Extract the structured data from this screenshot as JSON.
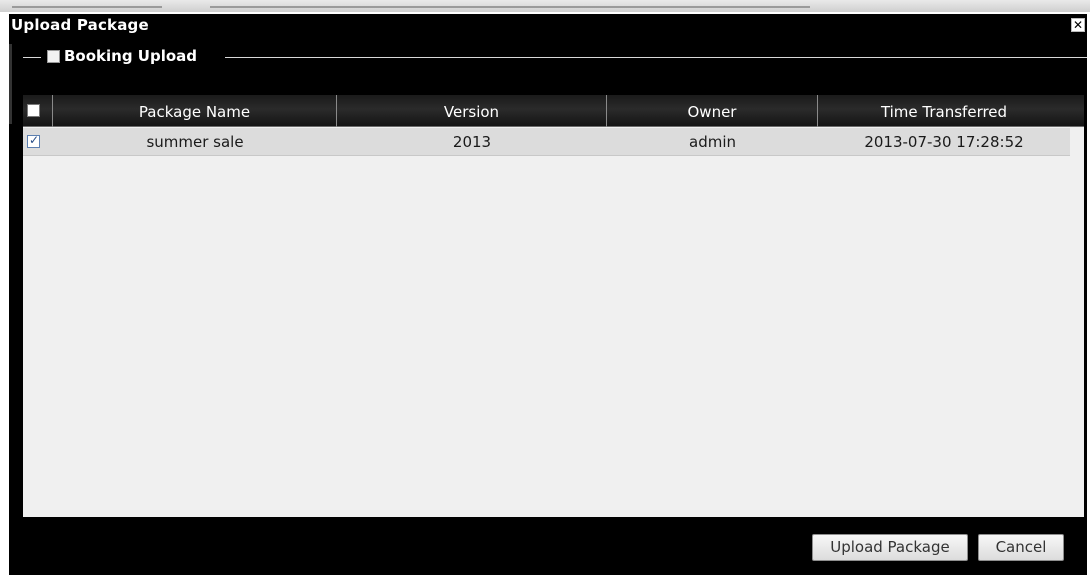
{
  "dialog": {
    "title": "Upload Package",
    "close_icon_glyph": "✕"
  },
  "fieldset": {
    "legend": "Booking Upload"
  },
  "grid": {
    "columns": [
      "Package Name",
      "Version",
      "Owner",
      "Time Transferred"
    ],
    "rows": [
      {
        "checked": true,
        "package_name": "summer sale",
        "version": "2013",
        "owner": "admin",
        "time_transferred": "2013-07-30 17:28:52"
      }
    ]
  },
  "buttons": {
    "upload": "Upload Package",
    "cancel": "Cancel"
  },
  "colors": {
    "dialog_bg": "#000000",
    "grid_bg": "#f0f0f0",
    "row_bg": "#dcdcdc",
    "header_text": "#ffffff"
  }
}
